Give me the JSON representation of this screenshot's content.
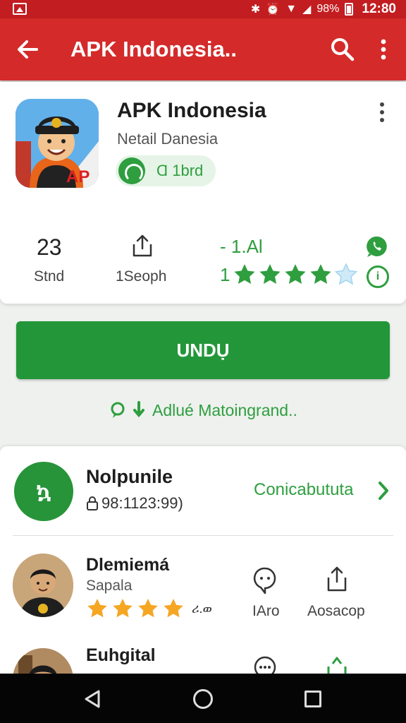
{
  "status_bar": {
    "battery": "98%",
    "time": "12:80"
  },
  "app_bar": {
    "title": "APK Indonesia.."
  },
  "app": {
    "name": "APK Indonesia",
    "developer": "Netail Danesia",
    "badge": "Ɑ 1brd",
    "icon_text": "AP"
  },
  "stats": [
    {
      "value": "23",
      "label": "Stnd"
    },
    {
      "label": "1Seoph"
    }
  ],
  "rating": {
    "value": "- 1.Al",
    "lead": "1",
    "stars": 4.5,
    "info_icon": "i"
  },
  "install_label": "UNDỤ",
  "added_note": "Adlué Matoingrand..",
  "security": {
    "logo_text": "ኳ",
    "title": "Nolpunile",
    "code": "98:1123:99)",
    "link": "Conicabututa"
  },
  "reviews": [
    {
      "name": "Dlemiemá",
      "sub": "Sapala",
      "stars": 4,
      "extra": "ሪ.ወ",
      "actions": [
        "IAro",
        "Aosacop"
      ]
    },
    {
      "name": "Euhgital",
      "sub": "",
      "stars": 0,
      "extra": "",
      "actions": [
        "",
        ""
      ]
    }
  ],
  "colors": {
    "appbar": "#d42a2a",
    "statusbar": "#c21d20",
    "accent_green": "#2e9e3f",
    "install": "#24963a",
    "star": "#f5a623",
    "star_green": "#2e9e3f"
  }
}
